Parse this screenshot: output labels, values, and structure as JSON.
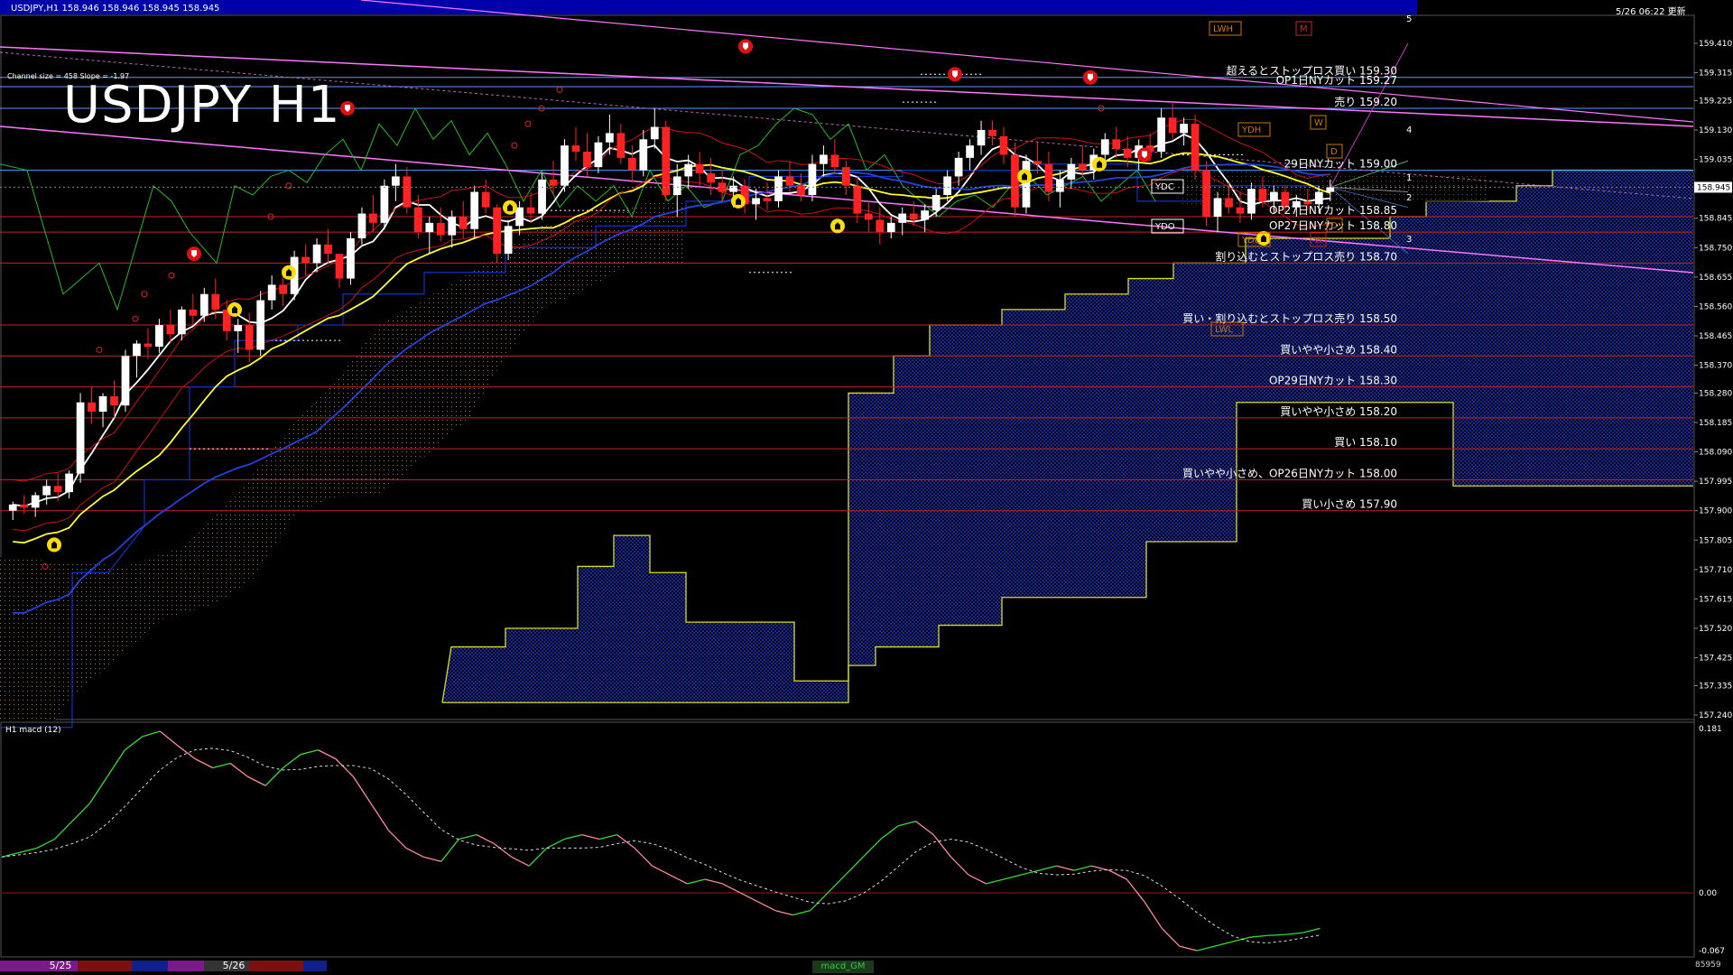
{
  "window": {
    "symbol_info": "USDJPY,H1  158.946 158.946 158.945 158.945",
    "big_title": "USDJPY H1",
    "channel_info": "Channel size = 458 Slope = -1.97",
    "timestamp": "5/26 06:22 更新",
    "macd_label": "H1  macd (12)",
    "macd_badge": "macd_GM",
    "counter": "85959",
    "date_tabs": [
      "5/25",
      "5/26"
    ]
  },
  "chart_data": {
    "type": "candlestick",
    "symbol": "USDJPY",
    "timeframe": "H1",
    "price_axis": {
      "min": 157.24,
      "max": 159.41,
      "ticks": [
        "159.410",
        "159.315",
        "159.225",
        "159.130",
        "159.035",
        "158.945",
        "158.845",
        "158.750",
        "158.655",
        "158.560",
        "158.465",
        "158.370",
        "158.280",
        "158.185",
        "158.090",
        "157.995",
        "157.900",
        "157.805",
        "157.710",
        "157.615",
        "157.520",
        "157.425",
        "157.335",
        "157.240"
      ],
      "current_price": "158.945"
    },
    "macd_axis": {
      "max": "0.181",
      "zero": "0.00",
      "min": "-0.067"
    },
    "levels": [
      {
        "price": 159.3,
        "label": "超えるとストップロス買い 159.30",
        "color": "#5599ff"
      },
      {
        "price": 159.27,
        "label": "OP1日NYカット 159.27",
        "color": "#5599ff"
      },
      {
        "price": 159.2,
        "label": "売り 159.20",
        "color": "#5599ff"
      },
      {
        "price": 159.0,
        "label": "29日NYカット 159.00",
        "color": "#5599ff"
      },
      {
        "price": 158.85,
        "label": "OP27日NYカット 158.85",
        "color": "#cc2222"
      },
      {
        "price": 158.8,
        "label": "OP27日NYカット 158.80",
        "color": "#cc2222"
      },
      {
        "price": 158.7,
        "label": "割り込むとストップロス売り 158.70",
        "color": "#cc2222"
      },
      {
        "price": 158.5,
        "label": "買い・割り込むとストップロス売り 158.50",
        "color": "#cc2222"
      },
      {
        "price": 158.4,
        "label": "買いやや小さめ 158.40",
        "color": "#cc2222"
      },
      {
        "price": 158.3,
        "label": "OP29日NYカット 158.30",
        "color": "#cc2222"
      },
      {
        "price": 158.2,
        "label": "買いやや小さめ 158.20",
        "color": "#cc2222"
      },
      {
        "price": 158.1,
        "label": "買い 158.10",
        "color": "#cc2222"
      },
      {
        "price": 158.0,
        "label": "買いやや小さめ、OP26日NYカット 158.00",
        "color": "#cc2222"
      },
      {
        "price": 157.9,
        "label": "買い小さめ 157.90",
        "color": "#cc2222"
      }
    ],
    "markers": [
      "LWH",
      "M",
      "YDH",
      "W",
      "D",
      "YDC",
      "YDO",
      "YDL",
      "W",
      "D",
      "LWL"
    ],
    "projection_numbers": [
      "5",
      "4",
      "1",
      "2",
      "3"
    ],
    "candles": [
      [
        157.9,
        157.93,
        157.87,
        157.92
      ],
      [
        157.92,
        157.95,
        157.89,
        157.91
      ],
      [
        157.91,
        157.96,
        157.88,
        157.95
      ],
      [
        157.95,
        158.0,
        157.92,
        157.98
      ],
      [
        157.98,
        158.02,
        157.93,
        157.96
      ],
      [
        157.96,
        158.03,
        157.94,
        158.02
      ],
      [
        158.02,
        158.28,
        157.99,
        158.25
      ],
      [
        158.25,
        158.3,
        158.18,
        158.22
      ],
      [
        158.22,
        158.28,
        158.17,
        158.27
      ],
      [
        158.27,
        158.32,
        158.2,
        158.24
      ],
      [
        158.24,
        158.42,
        158.22,
        158.4
      ],
      [
        158.4,
        158.45,
        158.33,
        158.44
      ],
      [
        158.44,
        158.49,
        158.39,
        158.43
      ],
      [
        158.43,
        158.52,
        158.41,
        158.5
      ],
      [
        158.5,
        158.55,
        158.44,
        158.47
      ],
      [
        158.47,
        158.56,
        158.45,
        158.55
      ],
      [
        158.55,
        158.6,
        158.5,
        158.53
      ],
      [
        158.53,
        158.62,
        158.51,
        158.6
      ],
      [
        158.6,
        158.65,
        158.52,
        158.55
      ],
      [
        158.55,
        158.58,
        158.45,
        158.48
      ],
      [
        158.48,
        158.52,
        158.41,
        158.5
      ],
      [
        158.5,
        158.54,
        158.38,
        158.42
      ],
      [
        158.42,
        158.61,
        158.4,
        158.58
      ],
      [
        158.58,
        158.66,
        158.55,
        158.63
      ],
      [
        158.63,
        158.68,
        158.56,
        158.6
      ],
      [
        158.6,
        158.74,
        158.58,
        158.72
      ],
      [
        158.72,
        158.76,
        158.66,
        158.7
      ],
      [
        158.7,
        158.78,
        158.67,
        158.76
      ],
      [
        158.76,
        158.81,
        158.7,
        158.73
      ],
      [
        158.73,
        158.7,
        158.62,
        158.65
      ],
      [
        158.65,
        158.8,
        158.63,
        158.78
      ],
      [
        158.78,
        158.88,
        158.76,
        158.86
      ],
      [
        158.86,
        158.92,
        158.8,
        158.83
      ],
      [
        158.83,
        158.97,
        158.81,
        158.95
      ],
      [
        158.95,
        159.02,
        158.9,
        158.98
      ],
      [
        158.98,
        159.01,
        158.86,
        158.88
      ],
      [
        158.88,
        158.92,
        158.78,
        158.8
      ],
      [
        158.8,
        158.85,
        158.73,
        158.83
      ],
      [
        158.83,
        158.88,
        158.77,
        158.79
      ],
      [
        158.79,
        158.87,
        158.75,
        158.85
      ],
      [
        158.85,
        158.9,
        158.78,
        158.81
      ],
      [
        158.81,
        158.95,
        158.78,
        158.93
      ],
      [
        158.93,
        158.97,
        158.86,
        158.88
      ],
      [
        158.88,
        158.89,
        158.7,
        158.73
      ],
      [
        158.73,
        158.84,
        158.71,
        158.82
      ],
      [
        158.82,
        158.9,
        158.79,
        158.88
      ],
      [
        158.88,
        158.93,
        158.83,
        158.86
      ],
      [
        158.86,
        158.99,
        158.84,
        158.97
      ],
      [
        158.97,
        159.03,
        158.92,
        158.95
      ],
      [
        158.95,
        159.1,
        158.93,
        159.08
      ],
      [
        159.08,
        159.14,
        159.03,
        159.06
      ],
      [
        159.06,
        159.12,
        158.98,
        159.01
      ],
      [
        159.01,
        159.11,
        158.99,
        159.09
      ],
      [
        159.09,
        159.18,
        159.05,
        159.12
      ],
      [
        159.12,
        159.15,
        159.02,
        159.04
      ],
      [
        159.04,
        159.08,
        158.96,
        159.0
      ],
      [
        159.0,
        159.13,
        158.98,
        159.1
      ],
      [
        159.1,
        159.2,
        159.07,
        159.14
      ],
      [
        159.14,
        159.16,
        158.9,
        158.92
      ],
      [
        158.92,
        159.02,
        158.85,
        158.98
      ],
      [
        158.98,
        159.05,
        158.94,
        159.02
      ],
      [
        159.02,
        159.06,
        158.95,
        158.99
      ],
      [
        158.99,
        159.04,
        158.92,
        158.96
      ],
      [
        158.96,
        159.0,
        158.9,
        158.93
      ],
      [
        158.93,
        158.98,
        158.88,
        158.95
      ],
      [
        158.95,
        158.97,
        158.86,
        158.89
      ],
      [
        158.89,
        158.94,
        158.84,
        158.91
      ],
      [
        158.91,
        158.96,
        158.87,
        158.9
      ],
      [
        158.9,
        159.0,
        158.88,
        158.98
      ],
      [
        158.98,
        159.03,
        158.93,
        158.95
      ],
      [
        158.95,
        158.99,
        158.9,
        158.92
      ],
      [
        158.92,
        159.05,
        158.9,
        159.02
      ],
      [
        159.02,
        159.08,
        158.98,
        159.05
      ],
      [
        159.05,
        159.1,
        158.99,
        159.01
      ],
      [
        159.01,
        159.03,
        158.92,
        158.95
      ],
      [
        158.95,
        158.98,
        158.83,
        158.86
      ],
      [
        158.86,
        158.9,
        158.8,
        158.84
      ],
      [
        158.84,
        158.88,
        158.76,
        158.8
      ],
      [
        158.8,
        158.85,
        158.78,
        158.83
      ],
      [
        158.83,
        158.88,
        158.79,
        158.86
      ],
      [
        158.86,
        158.9,
        158.82,
        158.84
      ],
      [
        158.84,
        158.89,
        158.8,
        158.87
      ],
      [
        158.87,
        158.94,
        158.85,
        158.92
      ],
      [
        158.92,
        159.0,
        158.9,
        158.98
      ],
      [
        158.98,
        159.06,
        158.95,
        159.04
      ],
      [
        159.04,
        159.1,
        159.0,
        159.08
      ],
      [
        159.08,
        159.16,
        159.05,
        159.13
      ],
      [
        159.13,
        159.16,
        159.08,
        159.11
      ],
      [
        159.11,
        159.14,
        159.02,
        159.05
      ],
      [
        159.05,
        159.09,
        158.85,
        158.88
      ],
      [
        158.88,
        159.05,
        158.86,
        159.03
      ],
      [
        159.03,
        159.09,
        158.99,
        159.02
      ],
      [
        159.02,
        159.06,
        158.9,
        158.93
      ],
      [
        158.93,
        159.0,
        158.88,
        158.97
      ],
      [
        158.97,
        159.04,
        158.94,
        159.02
      ],
      [
        159.02,
        159.08,
        158.98,
        159.0
      ],
      [
        159.0,
        159.07,
        158.97,
        159.05
      ],
      [
        159.05,
        159.12,
        159.02,
        159.1
      ],
      [
        159.1,
        159.14,
        159.04,
        159.07
      ],
      [
        159.07,
        159.11,
        159.01,
        159.04
      ],
      [
        159.04,
        159.1,
        159.0,
        159.08
      ],
      [
        159.08,
        159.12,
        159.03,
        159.06
      ],
      [
        159.06,
        159.2,
        159.04,
        159.17
      ],
      [
        159.17,
        159.22,
        159.1,
        159.12
      ],
      [
        159.12,
        159.17,
        159.08,
        159.15
      ],
      [
        159.15,
        159.18,
        158.97,
        159.0
      ],
      [
        159.0,
        159.03,
        158.82,
        158.85
      ],
      [
        158.85,
        158.93,
        158.8,
        158.91
      ],
      [
        158.91,
        158.96,
        158.86,
        158.88
      ],
      [
        158.88,
        158.93,
        158.83,
        158.86
      ],
      [
        158.86,
        158.96,
        158.84,
        158.94
      ],
      [
        158.94,
        158.98,
        158.88,
        158.9
      ],
      [
        158.9,
        158.95,
        158.86,
        158.93
      ],
      [
        158.93,
        158.95,
        158.86,
        158.88
      ],
      [
        158.88,
        158.92,
        158.85,
        158.9
      ],
      [
        158.9,
        158.94,
        158.87,
        158.89
      ],
      [
        158.89,
        158.95,
        158.86,
        158.93
      ],
      [
        158.93,
        158.97,
        158.9,
        158.945
      ]
    ],
    "series": [
      {
        "name": "MA short",
        "color": "#ffffff"
      },
      {
        "name": "MA mid",
        "color": "#ffff33"
      },
      {
        "name": "MA long",
        "color": "#2244dd"
      }
    ],
    "grid": false
  }
}
